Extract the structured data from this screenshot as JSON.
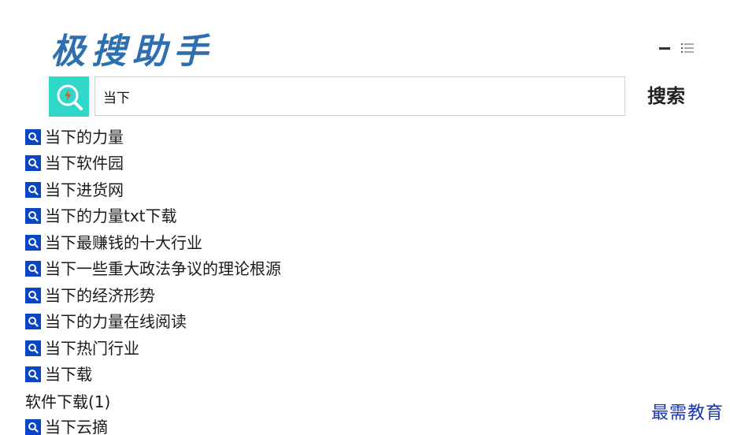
{
  "app": {
    "logo_text": "极搜助手"
  },
  "window": {
    "minimize_icon": "minimize-icon",
    "menu_icon": "hamburger-menu-icon"
  },
  "search": {
    "value": "当下",
    "button_label": "搜索",
    "badge_icon": "search-lightning-icon",
    "badge_color": "#2fd8c9"
  },
  "suggestions": [
    "当下的力量",
    "当下软件园",
    "当下进货网",
    "当下的力量txt下载",
    "当下最赚钱的十大行业",
    "当下一些重大政法争议的理论根源",
    "当下的经济形势",
    "当下的力量在线阅读",
    "当下热门行业",
    "当下载"
  ],
  "software_section": {
    "label": "软件下载(1)",
    "items": [
      "当下云摘"
    ]
  },
  "watermark": "最需教育",
  "colors": {
    "logo": "#2d6fb0",
    "suggestion_icon": "#0a45c8",
    "watermark": "#1a35a8"
  }
}
